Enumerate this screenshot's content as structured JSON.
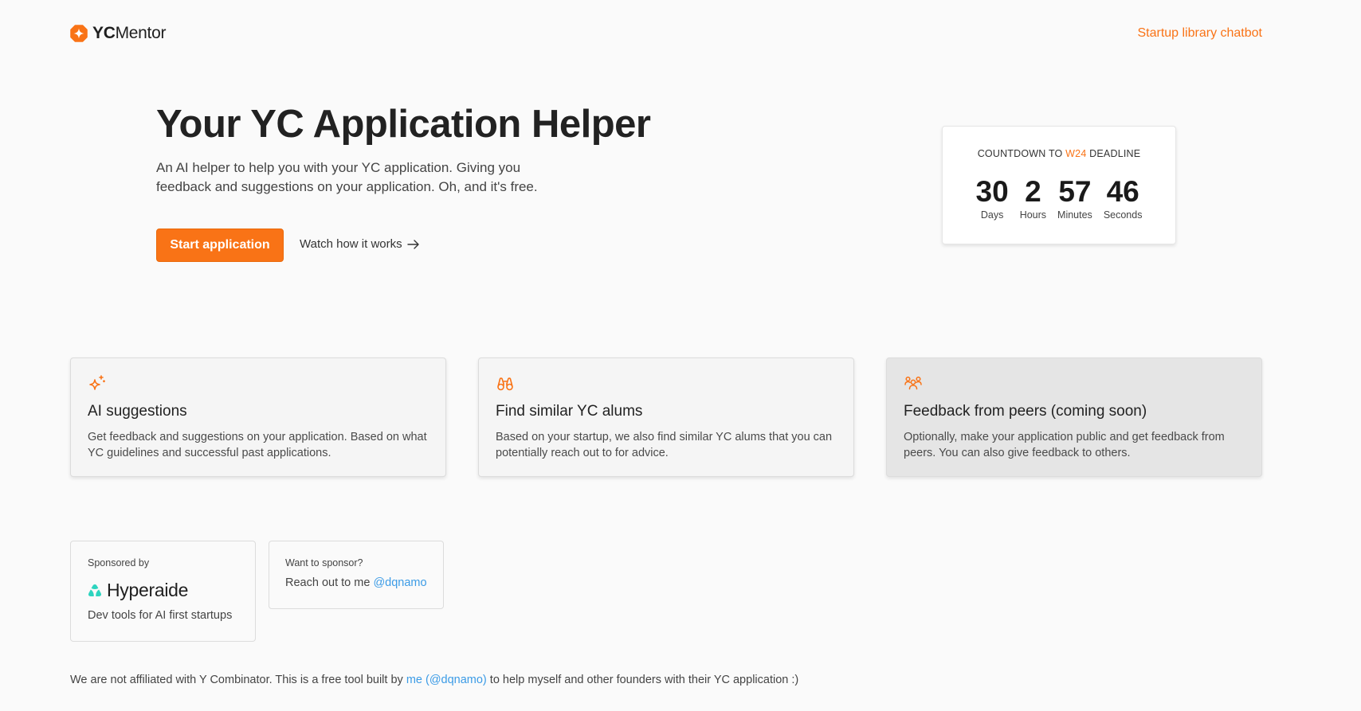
{
  "header": {
    "logo_bold": "YC",
    "logo_light": "Mentor",
    "nav_link": "Startup library chatbot"
  },
  "colors": {
    "accent": "#f97316",
    "link": "#3b9be6",
    "background": "#fafafa",
    "teal": "#2dd4bf"
  },
  "hero": {
    "title": "Your YC Application Helper",
    "subtitle": "An AI helper to help you with your YC application. Giving you feedback and suggestions on your application. Oh, and it's free.",
    "primary_button": "Start application",
    "secondary_link": "Watch how it works",
    "secondary_icon": "arrow-right-icon"
  },
  "countdown": {
    "title_prefix": "COUNTDOWN TO",
    "title_accent": "W24",
    "title_suffix": "DEADLINE",
    "units": [
      {
        "value": "30",
        "label": "Days"
      },
      {
        "value": "2",
        "label": "Hours"
      },
      {
        "value": "57",
        "label": "Minutes"
      },
      {
        "value": "46",
        "label": "Seconds"
      }
    ]
  },
  "features": [
    {
      "icon": "sparkles-icon",
      "title": "AI suggestions",
      "description": "Get feedback and suggestions on your application. Based on what YC guidelines and successful past applications."
    },
    {
      "icon": "binoculars-icon",
      "title": "Find similar YC alums",
      "description": "Based on your startup, we also find similar YC alums that you can potentially reach out to for advice."
    },
    {
      "icon": "users-icon",
      "title": "Feedback from peers (coming soon)",
      "description": "Optionally, make your application public and get feedback from peers. You can also give feedback to others."
    }
  ],
  "sponsor": {
    "label": "Sponsored by",
    "brand": "Hyperaide",
    "tagline": "Dev tools for AI first startups"
  },
  "want_sponsor": {
    "label": "Want to sponsor?",
    "text": "Reach out to me",
    "handle": "@dqnamo"
  },
  "footer": {
    "text_before": "We are not affiliated with Y Combinator. This is a free tool built by",
    "link": "me (@dqnamo)",
    "text_after": "to help myself and other founders with their YC application :)"
  }
}
